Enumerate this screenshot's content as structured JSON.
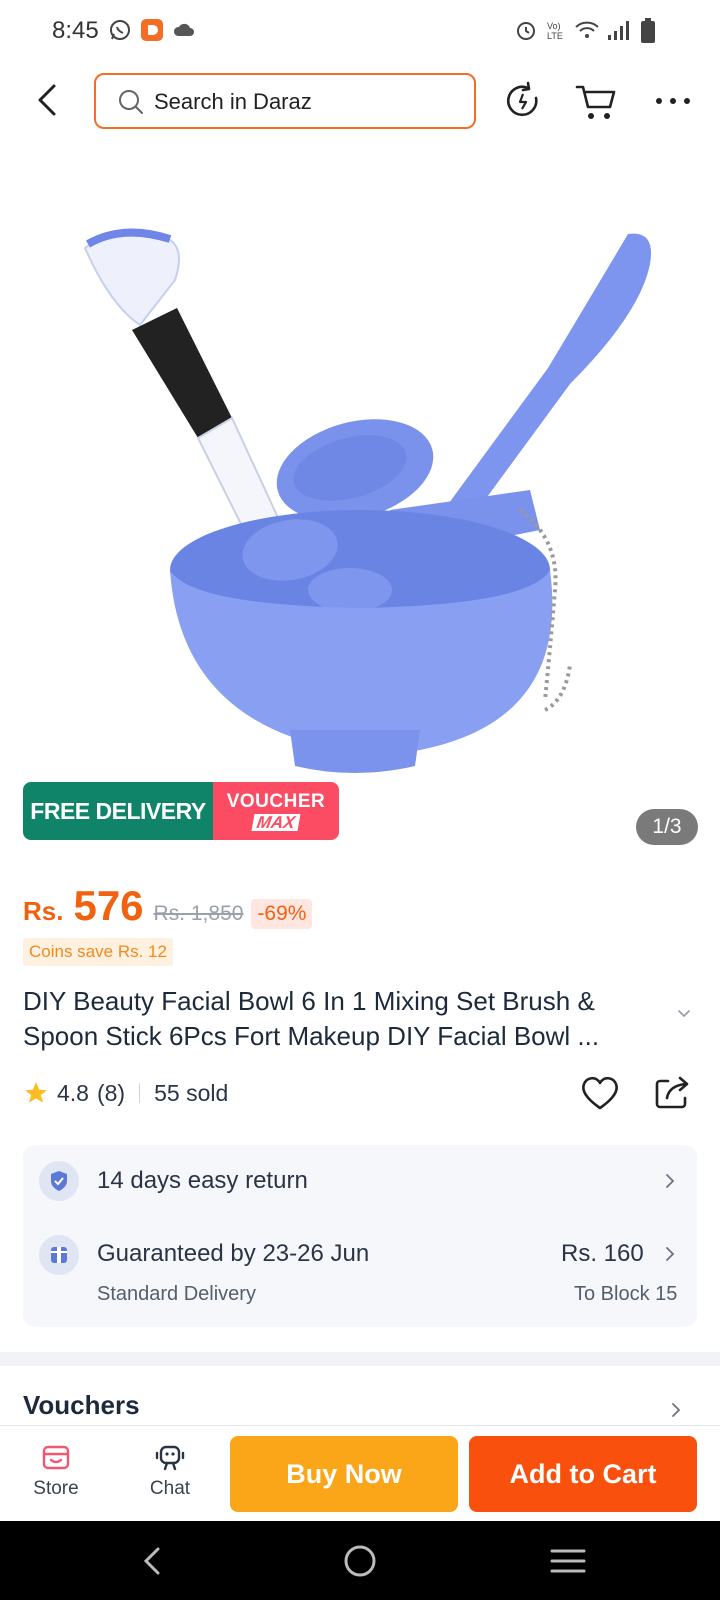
{
  "status_bar": {
    "time": "8:45"
  },
  "header": {
    "search_placeholder": "Search in Daraz"
  },
  "product": {
    "image_page": "1/3",
    "badges": {
      "free_delivery": "FREE DELIVERY",
      "voucher": "VOUCHER",
      "voucher_max": "MAX"
    },
    "currency": "Rs.",
    "price": "576",
    "old_price": "Rs. 1,850",
    "discount": "-69%",
    "coins": "Coins save Rs. 12",
    "title": "DIY Beauty Facial Bowl 6 In 1 Mixing Set Brush & Spoon Stick 6Pcs Fort Makeup DIY Facial Bowl ...",
    "rating": "4.8",
    "rating_count": "(8)",
    "sold": "55 sold"
  },
  "delivery": {
    "returns": "14 days easy return",
    "guarantee": "Guaranteed by 23-26 Jun",
    "delivery_type": "Standard Delivery",
    "fee": "Rs. 160",
    "location": "To Block 15"
  },
  "vouchers": {
    "title": "Vouchers"
  },
  "action_bar": {
    "store": "Store",
    "chat": "Chat",
    "buy_now": "Buy Now",
    "add_to_cart": "Add to Cart"
  },
  "colors": {
    "accent": "#f36d24",
    "price": "#f0620f",
    "buy_now": "#fba519",
    "add_to_cart": "#f9500d",
    "free_delivery": "#0f8468",
    "voucher": "#fb4c64"
  }
}
